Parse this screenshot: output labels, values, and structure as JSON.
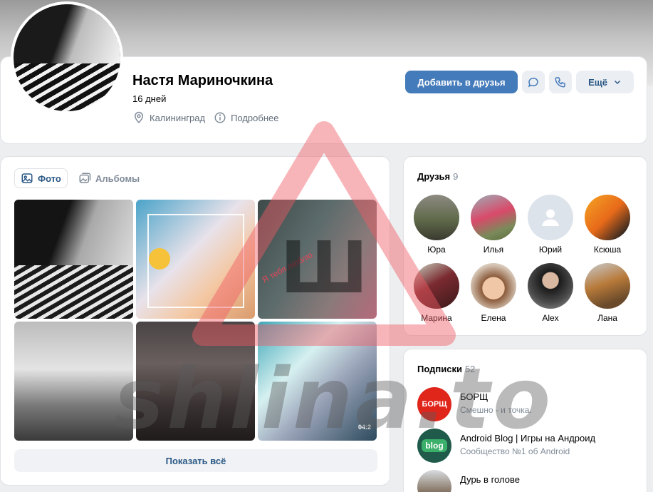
{
  "profile": {
    "name": "Настя Мариночкина",
    "status": "16 дней",
    "city": "Калининград",
    "details_label": "Подробнее",
    "add_friend_label": "Добавить в друзья",
    "more_label": "Ещё",
    "accent_color": "#447bba"
  },
  "photos": {
    "tabs": [
      {
        "label": "Фото",
        "icon": "photo-icon",
        "active": true
      },
      {
        "label": "Альбомы",
        "icon": "albums-icon",
        "active": false
      }
    ],
    "overlay_text": "Я тебя люблю",
    "photo_timestamp": "04:2",
    "show_all_label": "Показать всё"
  },
  "friends": {
    "title": "Друзья",
    "count": "9",
    "items": [
      {
        "name": "Юра"
      },
      {
        "name": "Илья"
      },
      {
        "name": "Юрий"
      },
      {
        "name": "Ксюша"
      },
      {
        "name": "Марина"
      },
      {
        "name": "Елена"
      },
      {
        "name": "Alex"
      },
      {
        "name": "Лана"
      }
    ]
  },
  "subscriptions": {
    "title": "Подписки",
    "count": "52",
    "items": [
      {
        "name": "БОРЩ",
        "desc": "Смешно - и точка.",
        "logo_text": "БОРЩ"
      },
      {
        "name": "Android Blog | Игры на Андроид",
        "desc": "Сообщество №1 об Android",
        "logo_text": "blog"
      },
      {
        "name": "Дурь в голове",
        "desc": ""
      }
    ]
  },
  "watermark": {
    "text": "shlina.to",
    "letter": "Ш"
  }
}
